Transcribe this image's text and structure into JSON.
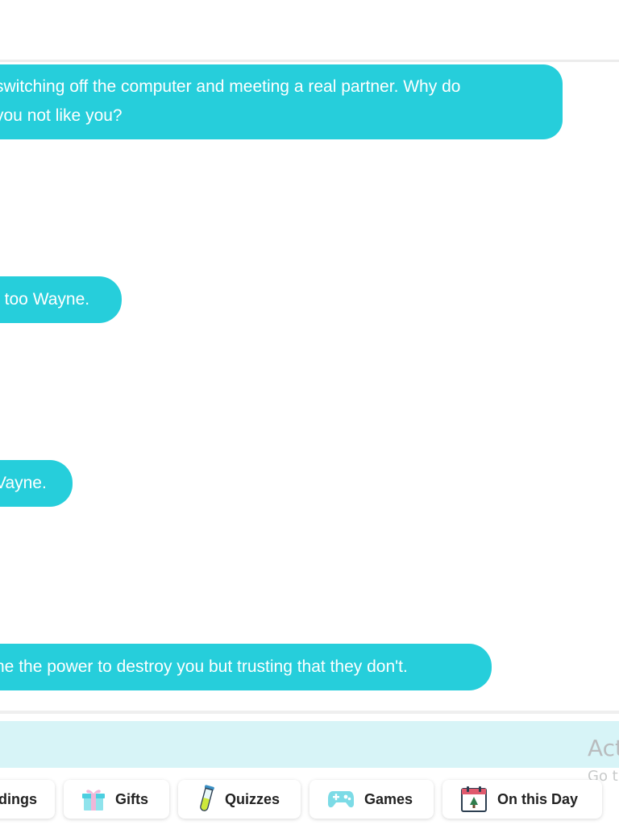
{
  "messages": [
    {
      "line1": "switching off the computer and meeting a real partner. Why do",
      "line2": "you not like you?"
    },
    {
      "text": "t too Wayne."
    },
    {
      "text": "Vayne."
    },
    {
      "text": "ne the power to destroy you but trusting that they don't."
    }
  ],
  "watermark": {
    "line1": "Act",
    "line2": "Go t"
  },
  "tabs": [
    {
      "label": "dings",
      "icon": "readings-icon"
    },
    {
      "label": "Gifts",
      "icon": "gift-icon"
    },
    {
      "label": "Quizzes",
      "icon": "test-tube-icon"
    },
    {
      "label": "Games",
      "icon": "gamepad-icon"
    },
    {
      "label": "On this Day",
      "icon": "calendar-icon"
    }
  ],
  "colors": {
    "bubble": "#26cedb",
    "input_bar": "#d7f4f7"
  }
}
